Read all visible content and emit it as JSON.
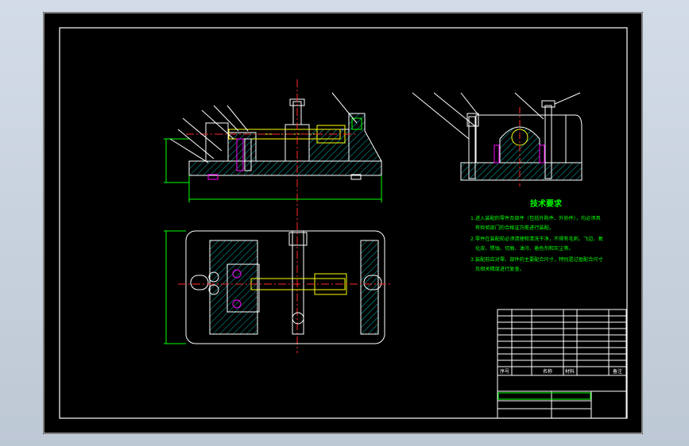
{
  "colors": {
    "background": "#000000",
    "frame": "#ffffff",
    "outline": "#ffffff",
    "centerline": "#ff2a2a",
    "hatch": "#00b0b0",
    "highlight": "#ffff00",
    "dimension": "#00ff00",
    "text": "#00ff00",
    "accent": "#ff00ff"
  },
  "tech_requirements": {
    "title": "技术要求",
    "lines": [
      "1.进入装配的零件及部件（包括外购件、外协件），均必须具",
      "有检验部门的合格证方能进行装配。",
      "2.零件在装配前必须清理和清洗干净，不得有毛刺、飞边、氧",
      "化皮、锈蚀、切屑、油污、着色剂和灰尘等。",
      "3.装配前应对零、部件的主要配合尺寸，特别是过盈配合尺寸",
      "及相关精度进行复查。"
    ]
  },
  "title_block": {
    "header_seq": "序号",
    "header_name": "名称",
    "header_material": "材料",
    "header_remark": "备注"
  }
}
